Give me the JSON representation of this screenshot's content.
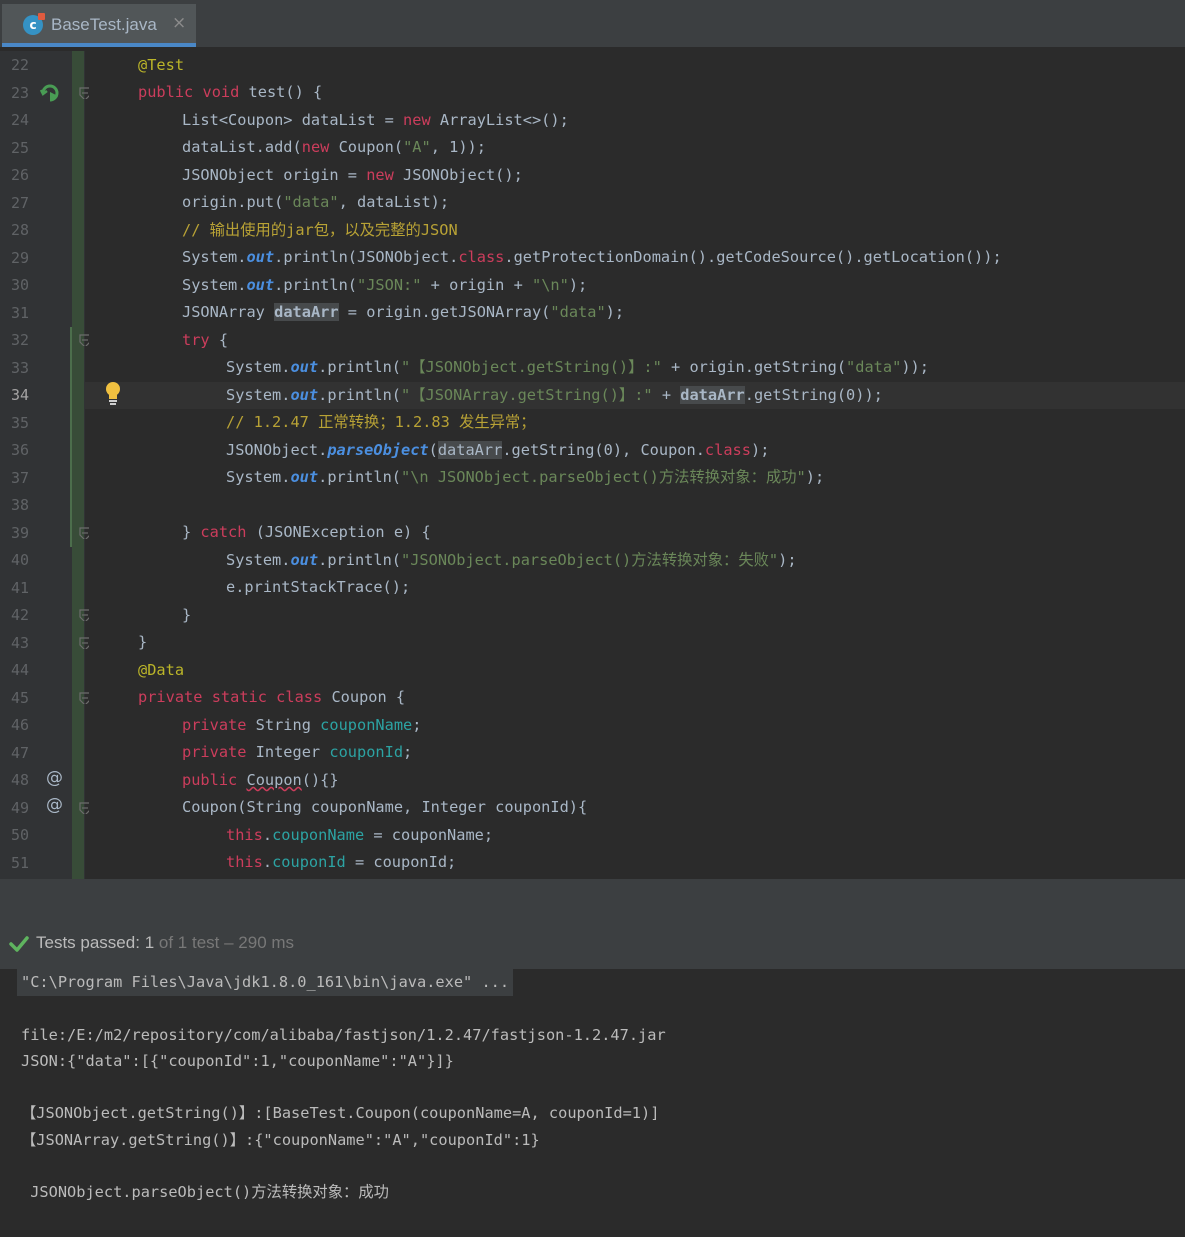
{
  "tab": {
    "filename": "BaseTest.java",
    "file_icon": "c",
    "close_label": "×"
  },
  "gutter": {
    "line_numbers": [
      "22",
      "23",
      "24",
      "25",
      "26",
      "27",
      "28",
      "29",
      "30",
      "31",
      "32",
      "33",
      "34",
      "35",
      "36",
      "37",
      "38",
      "39",
      "40",
      "41",
      "42",
      "43",
      "44",
      "45",
      "46",
      "47",
      "48",
      "49",
      "50",
      "51"
    ],
    "current_line": "34",
    "at_marker": "@"
  },
  "code": {
    "l22": {
      "ann": "@Test"
    },
    "l23": {
      "p1": "public",
      "p2": "void",
      "p3": " test() {"
    },
    "l24": {
      "p1": "List<Coupon> dataList = ",
      "p2": "new",
      "p3": " ArrayList<>();"
    },
    "l25": {
      "p1": "dataList.add(",
      "p2": "new",
      "p3": " Coupon(",
      "p4": "\"A\"",
      "p5": ", 1));"
    },
    "l26": {
      "p1": "JSONObject origin = ",
      "p2": "new",
      "p3": " JSONObject();"
    },
    "l27": {
      "p1": "origin.put(",
      "p2": "\"data\"",
      "p3": ", dataList);"
    },
    "l28": {
      "comment": "// 输出使用的jar包，以及完整的JSON"
    },
    "l29": {
      "p1": "System.",
      "p2": "out",
      "p3": ".println(JSONObject.",
      "p4": "class",
      "p5": ".getProtectionDomain().getCodeSource().getLocation());"
    },
    "l30": {
      "p1": "System.",
      "p2": "out",
      "p3": ".println(",
      "p4": "\"JSON:\"",
      "p5": " + origin + ",
      "p6": "\"\\n\"",
      "p7": ");"
    },
    "l31": {
      "p1": "JSONArray ",
      "p2": "dataArr",
      "p3": " = origin.getJSONArray(",
      "p4": "\"data\"",
      "p5": ");"
    },
    "l32": {
      "p1": "try",
      "p2": " {"
    },
    "l33": {
      "p1": "System.",
      "p2": "out",
      "p3": ".println(",
      "p4": "\"【JSONObject.getString()】:\"",
      "p5": " + origin.getString(",
      "p6": "\"data\"",
      "p7": "));"
    },
    "l34": {
      "p1": "System.",
      "p2": "out",
      "p3": ".println(",
      "p4": "\"【JSONArray.getString()】:\"",
      "p5": " + ",
      "p6": "dataArr",
      "p7": ".getString(0));"
    },
    "l35": {
      "comment": "// 1.2.47 正常转换；1.2.83 发生异常；"
    },
    "l36": {
      "p1": "JSONObject.",
      "p2": "parseObject",
      "p3": "(",
      "p4": "dataArr",
      "p5": ".getString(0), Coupon.",
      "p6": "class",
      "p7": ");"
    },
    "l37": {
      "p1": "System.",
      "p2": "out",
      "p3": ".println(",
      "p4": "\"\\n JSONObject.parseObject()方法转换对象：成功\"",
      "p5": ");"
    },
    "l39": {
      "p1": "} ",
      "p2": "catch",
      "p3": " (JSONException e) {"
    },
    "l40": {
      "p1": "System.",
      "p2": "out",
      "p3": ".println(",
      "p4": "\"JSONObject.parseObject()方法转换对象：失败\"",
      "p5": ");"
    },
    "l41": {
      "p1": "e.printStackTrace();"
    },
    "l42": {
      "p1": "}"
    },
    "l43": {
      "p1": "}"
    },
    "l44": {
      "ann": "@Data"
    },
    "l45": {
      "p1": "private",
      "p2": "static",
      "p3": "class",
      "p4": " Coupon {"
    },
    "l46": {
      "p1": "private",
      "p2": " String ",
      "p3": "couponName",
      "p4": ";"
    },
    "l47": {
      "p1": "private",
      "p2": " Integer ",
      "p3": "couponId",
      "p4": ";"
    },
    "l48": {
      "p1": "public",
      "p2": "Coupon",
      "p3": "(){}"
    },
    "l49": {
      "p1": "Coupon(String couponName, Integer couponId){"
    },
    "l50": {
      "p1": "this",
      "p2": ".",
      "p3": "couponName",
      "p4": " = couponName;"
    },
    "l51": {
      "p1": "this",
      "p2": ".",
      "p3": "couponId",
      "p4": " = couponId;"
    }
  },
  "status": {
    "label": "Tests passed:",
    "passed": "1",
    "of_text": "of 1 test",
    "time": "– 290 ms"
  },
  "console": {
    "lines": [
      "\"C:\\Program Files\\Java\\jdk1.8.0_161\\bin\\java.exe\" ...",
      "file:/E:/m2/repository/com/alibaba/fastjson/1.2.47/fastjson-1.2.47.jar",
      "JSON:{\"data\":[{\"couponId\":1,\"couponName\":\"A\"}]}",
      "【JSONObject.getString()】:[BaseTest.Coupon(couponName=A, couponId=1)]",
      "【JSONArray.getString()】:{\"couponName\":\"A\",\"couponId\":1}",
      " JSONObject.parseObject()方法转换对象：成功"
    ]
  },
  "colors": {
    "keyword": "#cc3d5c",
    "string": "#6a8759",
    "comment": "#b8a235",
    "field": "#2ca3a3",
    "static_out": "#4b8fe0",
    "accent": "#4a88c7",
    "pass_green": "#5fb45f"
  }
}
